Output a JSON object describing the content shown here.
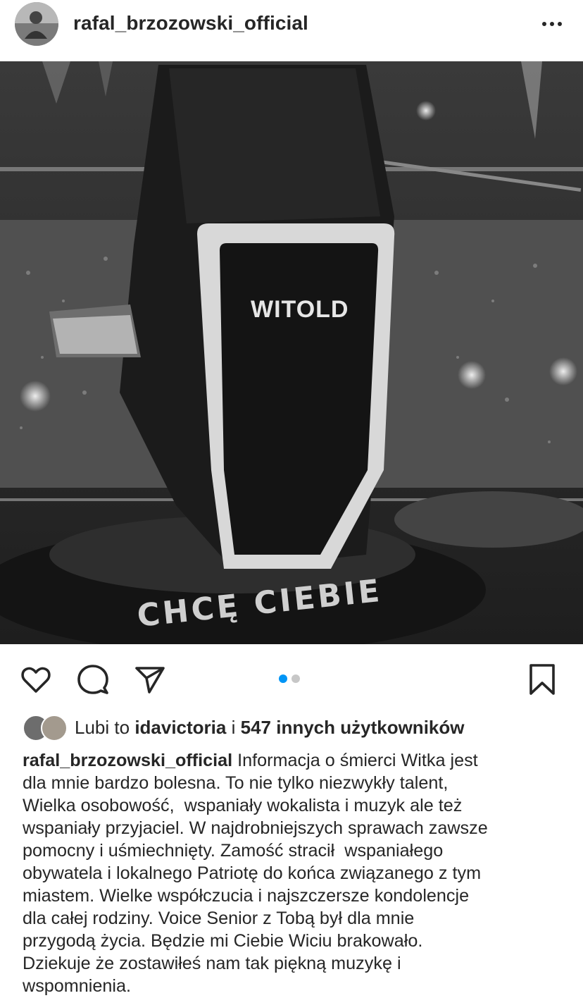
{
  "post": {
    "username": "rafal_brzozowski_official",
    "photo": {
      "chair_name_label": "WITOLD",
      "base_label": "CHCĘ CIEBIE"
    },
    "carousel": {
      "count": 2,
      "active_index": 0
    },
    "likes": {
      "prefix": "Lubi to",
      "liker_username": "idavictoria",
      "conjunction": "i",
      "others_text": "547 innych użytkowników"
    },
    "caption": {
      "author": "rafal_brzozowski_official",
      "lines": [
        "Informacja o śmierci Witka jest",
        "dla mnie bardzo bolesna. To nie tylko niezwykły talent,",
        "Wielka osobowość,  wspaniały wokalista i muzyk ale też",
        "wspaniały przyjaciel. W najdrobniejszych sprawach zawsze",
        "pomocny i uśmiechnięty. Zamość stracił  wspaniałego",
        "obywatela i lokalnego Patriotę do końca związanego z tym",
        "miastem. Wielke współczucia i najszczersze kondolencje",
        "dla całej rodziny. Voice Senior z Tobą był dla mnie",
        "przygodą życia. Będzie mi Ciebie Wiciu brakowało.",
        "Dziekuje że zostawiłeś nam tak piękną muzykę i",
        "wspomnienia."
      ]
    }
  },
  "icons": {
    "avatar": "profile-avatar",
    "more": "more-options-icon",
    "like": "heart-icon",
    "comment": "comment-icon",
    "share": "paper-plane-icon",
    "save": "bookmark-icon"
  },
  "colors": {
    "text": "#262626",
    "carousel_active": "#0095f6",
    "carousel_inactive": "#c7c7c7"
  }
}
